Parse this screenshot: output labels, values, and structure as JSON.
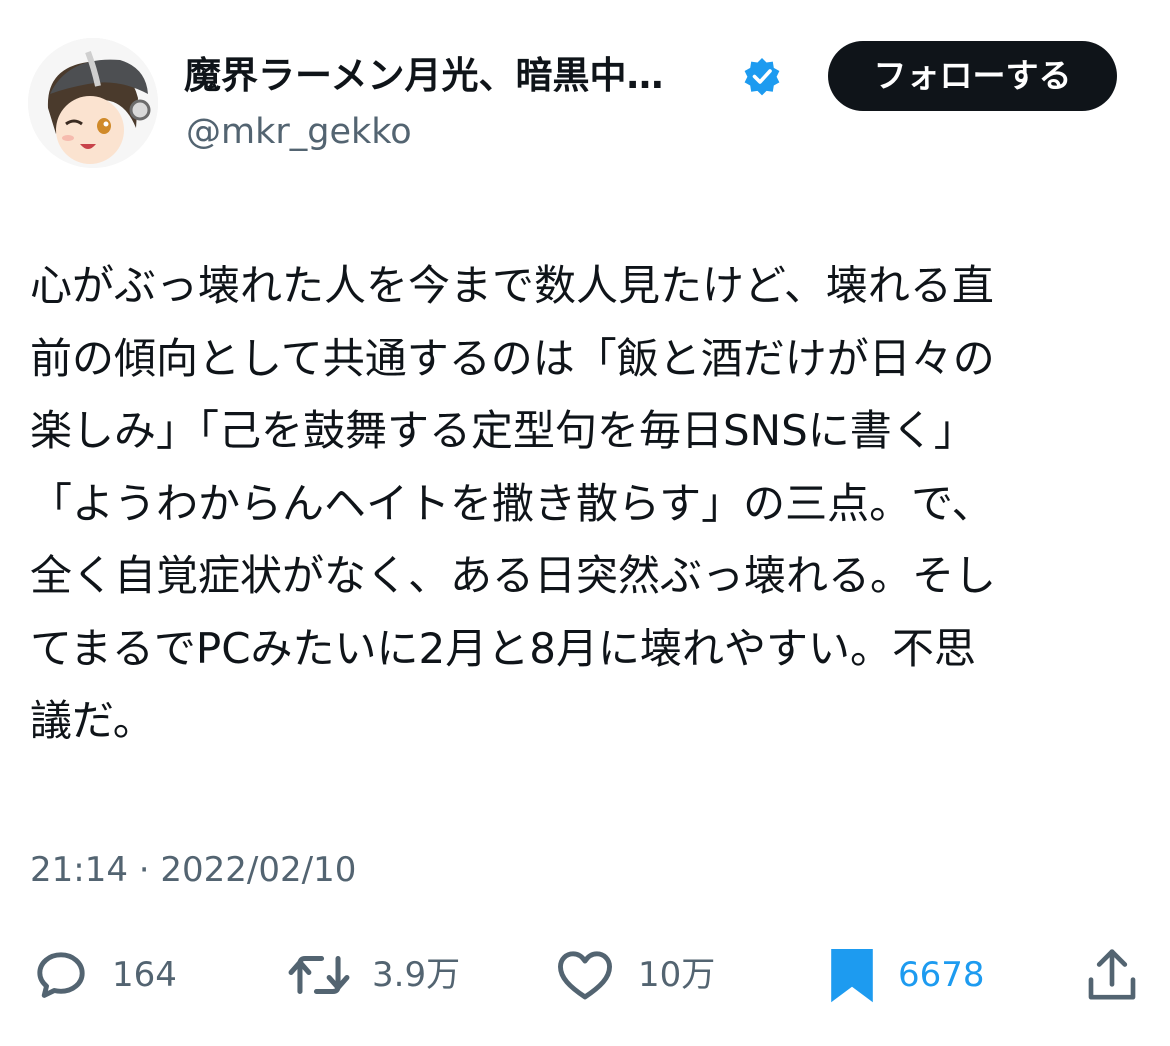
{
  "colors": {
    "text_primary": "#0f1419",
    "text_secondary": "#536471",
    "accent": "#1d9bf0",
    "follow_button_bg": "#0f1419",
    "follow_button_text": "#ffffff"
  },
  "header": {
    "display_name": "魔界ラーメン月光、暗黒中…",
    "handle": "@mkr_gekko",
    "verified_icon": "verified-badge-icon",
    "follow_label": "フォローする"
  },
  "tweet": {
    "lines": [
      "心がぶっ壊れた人を今まで数人見たけど、壊れる直",
      "前の傾向として共通するのは「飯と酒だけが日々の",
      "楽しみ」「己を鼓舞する定型句を毎日SNSに書く」",
      "「ようわからんヘイトを撒き散らす」の三点。で、",
      "全く自覚症状がなく、ある日突然ぶっ壊れる。そし",
      "てまるでPCみたいに2月と8月に壊れやすい。不思",
      "議だ。"
    ],
    "timestamp": "21:14 · 2022/02/10"
  },
  "actions": {
    "reply": {
      "icon": "reply-icon",
      "count": "164"
    },
    "retweet": {
      "icon": "retweet-icon",
      "count": "3.9万"
    },
    "like": {
      "icon": "heart-icon",
      "count": "10万"
    },
    "bookmark": {
      "icon": "bookmark-icon",
      "count": "6678",
      "active": true
    },
    "share": {
      "icon": "share-icon"
    }
  }
}
